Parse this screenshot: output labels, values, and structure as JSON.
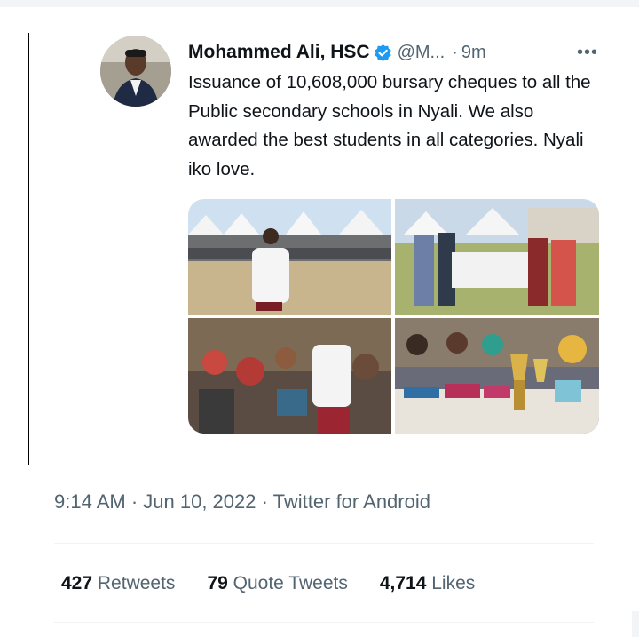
{
  "tweet": {
    "author_name": "Mohammed Ali, HSC",
    "handle": "@M...",
    "separator": "·",
    "time_ago": "9m",
    "more": "•••",
    "text": "Issuance of 10,608,000 bursary cheques to all the Public secondary schools in Nyali. We also awarded the best students in all categories. Nyali iko love.",
    "verified_icon": "verified-badge-icon",
    "colors": {
      "verified": "#1d9bf0",
      "text": "#0f1419",
      "secondary": "#536471"
    }
  },
  "meta": {
    "time": "9:14 AM",
    "sep1": " · ",
    "date": "Jun 10, 2022",
    "sep2": " · ",
    "source": "Twitter for Android"
  },
  "stats": {
    "retweets_count": "427",
    "retweets_label": "Retweets",
    "quotes_count": "79",
    "quotes_label": "Quote Tweets",
    "likes_count": "4,714",
    "likes_label": "Likes"
  }
}
